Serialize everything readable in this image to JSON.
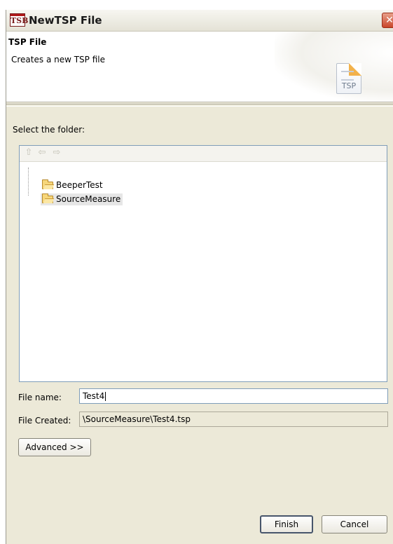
{
  "window": {
    "title": "NewTSP File",
    "app_icon_text": "TSB",
    "close_glyph": "✕"
  },
  "header": {
    "title": "TSP File",
    "description": "Creates a new TSP file",
    "icon_label": "TSP"
  },
  "folder_section": {
    "label": "Select the folder:",
    "toolbar": {
      "up": "⇧",
      "back": "⇦",
      "forward": "⇨"
    },
    "tree": [
      {
        "label": "BeeperTest",
        "icon": "folder-icon",
        "selected": false
      },
      {
        "label": "SourceMeasure",
        "icon": "folder-icon",
        "selected": true
      }
    ]
  },
  "file_name": {
    "label": "File name:",
    "value": "Test4"
  },
  "file_created": {
    "label": "File Created:",
    "value": "\\SourceMeasure\\Test4.tsp"
  },
  "buttons": {
    "advanced": "Advanced >>",
    "finish": "Finish",
    "cancel": "Cancel"
  },
  "colors": {
    "dialog_bg": "#ece9d8",
    "field_border": "#7f9db9",
    "close_button": "#c9462b"
  }
}
